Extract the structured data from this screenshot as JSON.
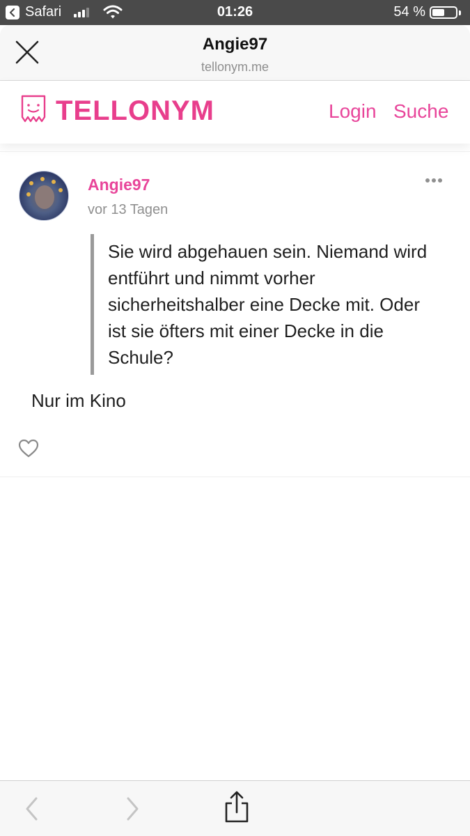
{
  "status_bar": {
    "back_app": "Safari",
    "time": "01:26",
    "battery": "54 %",
    "battery_level": 0.54
  },
  "browser": {
    "title": "Angie97",
    "url": "tellonym.me"
  },
  "site": {
    "logo_text": "TELLONYM",
    "nav": {
      "login": "Login",
      "search": "Suche"
    },
    "brand_color": "#e83e8c"
  },
  "post": {
    "username": "Angie97",
    "time": "vor 13 Tagen",
    "quote": "Sie wird abgehauen sein. Niemand wird entführt und nimmt vorher sicherheitshalber eine Decke mit. Oder ist sie öfters mit einer Decke in die Schule?",
    "answer": "Nur im Kino"
  },
  "icons": {
    "close": "close-icon",
    "more": "more-icon",
    "like": "heart-icon",
    "back": "chevron-left-icon",
    "forward": "chevron-right-icon",
    "share": "share-icon"
  }
}
